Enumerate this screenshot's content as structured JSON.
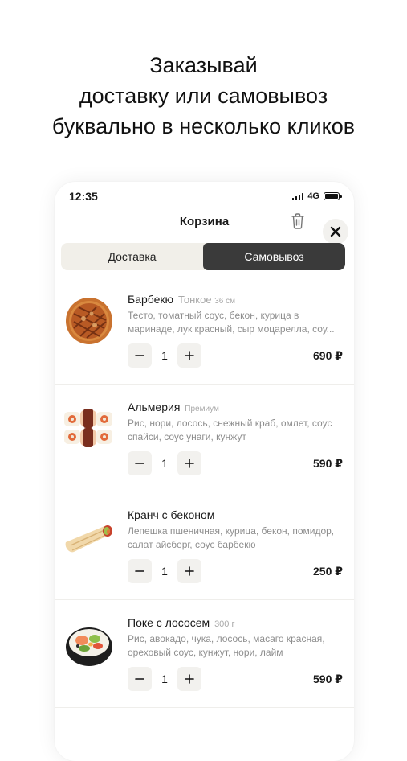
{
  "headline": {
    "line1": "Заказывай",
    "line2": "доставку или самовывоз",
    "line3": "буквально в несколько кликов"
  },
  "status_bar": {
    "time": "12:35",
    "network": "4G"
  },
  "header": {
    "title": "Корзина"
  },
  "tabs": [
    {
      "label": "Доставка",
      "active": false
    },
    {
      "label": "Самовывоз",
      "active": true
    }
  ],
  "items": [
    {
      "name": "Барбекю",
      "variant": "Тонкое",
      "variant_size": "36 см",
      "description": "Тесто, томатный соус, бекон, курица в маринаде, лук красный, сыр моцарелла, соу...",
      "quantity": "1",
      "price": "690 ₽",
      "image_icon": "pizza-icon"
    },
    {
      "name": "Альмерия",
      "variant": "Премиум",
      "variant_size": "",
      "description": "Рис, нори, лосось, снежный краб, омлет, соус спайси, соус унаги, кунжут",
      "quantity": "1",
      "price": "590 ₽",
      "image_icon": "sushi-roll-icon"
    },
    {
      "name": "Кранч с беконом",
      "variant": "",
      "variant_size": "",
      "description": "Лепешка пшеничная, курица, бекон, помидор, салат айсберг, соус барбекю",
      "quantity": "1",
      "price": "250 ₽",
      "image_icon": "wrap-icon"
    },
    {
      "name": "Поке с лососем",
      "variant": "300 г",
      "variant_size": "",
      "description": "Рис, авокадо, чука, лосось, масаго красная, ореховый соус, кунжут, нори, лайм",
      "quantity": "1",
      "price": "590 ₽",
      "image_icon": "poke-bowl-icon"
    }
  ],
  "colors": {
    "active_tab": "#3a3a3a",
    "segment_bg": "#f1efe9",
    "muted_text": "#8e8e8e",
    "button_bg": "#f2f1ee"
  }
}
